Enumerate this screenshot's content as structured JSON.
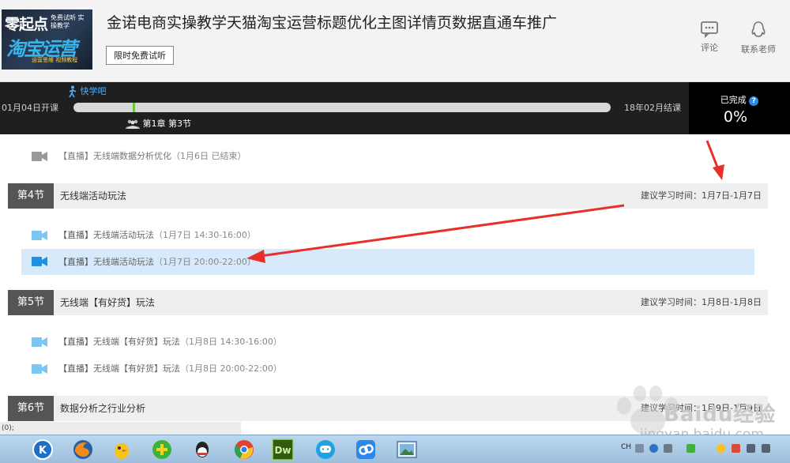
{
  "header": {
    "cover_text_main": "零起点",
    "cover_text_sub": "淘宝运营",
    "cover_badge": "免费试听 实操教学",
    "cover_tag": "运营思维 视频教程",
    "title": "金诺电商实操教学天猫淘宝运营标题优化主图详情页数据直通车推广",
    "trial_label": "限时免费试听",
    "actions": [
      {
        "label": "评论",
        "icon": "comment-icon"
      },
      {
        "label": "联系老师",
        "icon": "qq-penguin-icon"
      }
    ]
  },
  "progress": {
    "brand": "快学吧",
    "start_date": "01月04日开课",
    "end_date": "18年02月结课",
    "marker_fraction": 0.11,
    "chapter_label": "第1章 第3节",
    "completed_label": "已完成",
    "completed_percent": "0%"
  },
  "lessons": {
    "prev_item": {
      "tag": "【直播】",
      "title": "无线端数据分析优化",
      "time": "（1月6日 已结束）"
    },
    "sections": [
      {
        "no": "第4节",
        "title": "无线端活动玩法",
        "suggest": "建议学习时间：1月7日-1月7日",
        "items": [
          {
            "tag": "【直播】",
            "title": "无线端活动玩法",
            "time": "（1月7日 14:30-16:00）"
          },
          {
            "tag": "【直播】",
            "title": "无线端活动玩法",
            "time": "（1月7日 20:00-22:00）",
            "active": true
          }
        ]
      },
      {
        "no": "第5节",
        "title": "无线端【有好货】玩法",
        "suggest": "建议学习时间：1月8日-1月8日",
        "items": [
          {
            "tag": "【直播】",
            "title": "无线端【有好货】玩法",
            "time": "（1月8日 14:30-16:00）"
          },
          {
            "tag": "【直播】",
            "title": "无线端【有好货】玩法",
            "time": "（1月8日 20:00-22:00）"
          }
        ]
      },
      {
        "no": "第6节",
        "title": "数据分析之行业分析",
        "suggest": "建议学习时间：1月9日-1月9日"
      }
    ]
  },
  "status_text": "(0);",
  "taskbar": {
    "apps": [
      "kugou-icon",
      "firefox-icon",
      "chick-app-icon",
      "add-green-icon",
      "qq-icon",
      "chrome-icon",
      "dreamweaver-icon",
      "qq-messenger-icon",
      "baidu-netdisk-icon",
      "image-viewer-icon"
    ],
    "dreamweaver_label": "Dw",
    "tray_lang": "CH"
  },
  "watermark": {
    "brand": "Baidu经验",
    "url": "jingyan.baidu.com"
  },
  "colors": {
    "accent_blue": "#2d8ae8",
    "dark_band": "#1f1f1f",
    "active_row": "#d6eafb",
    "section_no_bg": "#555555",
    "annotation_red": "#e8302a"
  }
}
